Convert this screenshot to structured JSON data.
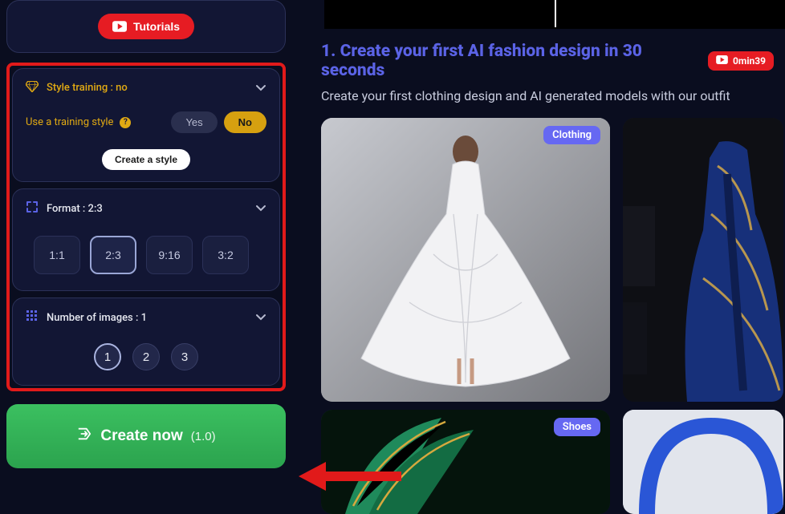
{
  "sidebar": {
    "tutorials_label": "Tutorials",
    "style": {
      "title": "Style training : no",
      "use_label": "Use a training style",
      "yes": "Yes",
      "no": "No",
      "create_label": "Create a style"
    },
    "format": {
      "title": "Format : 2:3",
      "options": [
        "1:1",
        "2:3",
        "9:16",
        "3:2"
      ],
      "selected": "2:3"
    },
    "count": {
      "title": "Number of images : 1",
      "options": [
        "1",
        "2",
        "3"
      ],
      "selected": "1"
    },
    "create_now": {
      "label": "Create now",
      "sub": "(1.0)"
    }
  },
  "main": {
    "heading_number": "1.",
    "heading": "1. Create your first AI fashion design in 30 seconds",
    "time_pill": "0min39",
    "description": "Create your first clothing design and AI generated models with our outfit",
    "tags": {
      "clothing": "Clothing",
      "shoes": "Shoes"
    }
  },
  "icons": {
    "youtube": "youtube-icon",
    "diamond": "diamond-icon",
    "help": "?",
    "chevron_down": "⌄",
    "crop": "crop-icon",
    "grid": "grid-icon",
    "export": "export-icon"
  },
  "colors": {
    "accent_gold": "#e0a913",
    "accent_blue": "#5b63e6",
    "accent_green": "#2ba34e",
    "accent_red": "#e61c23",
    "highlight_border": "#e11a1a",
    "tag_bg": "#6668f2"
  }
}
